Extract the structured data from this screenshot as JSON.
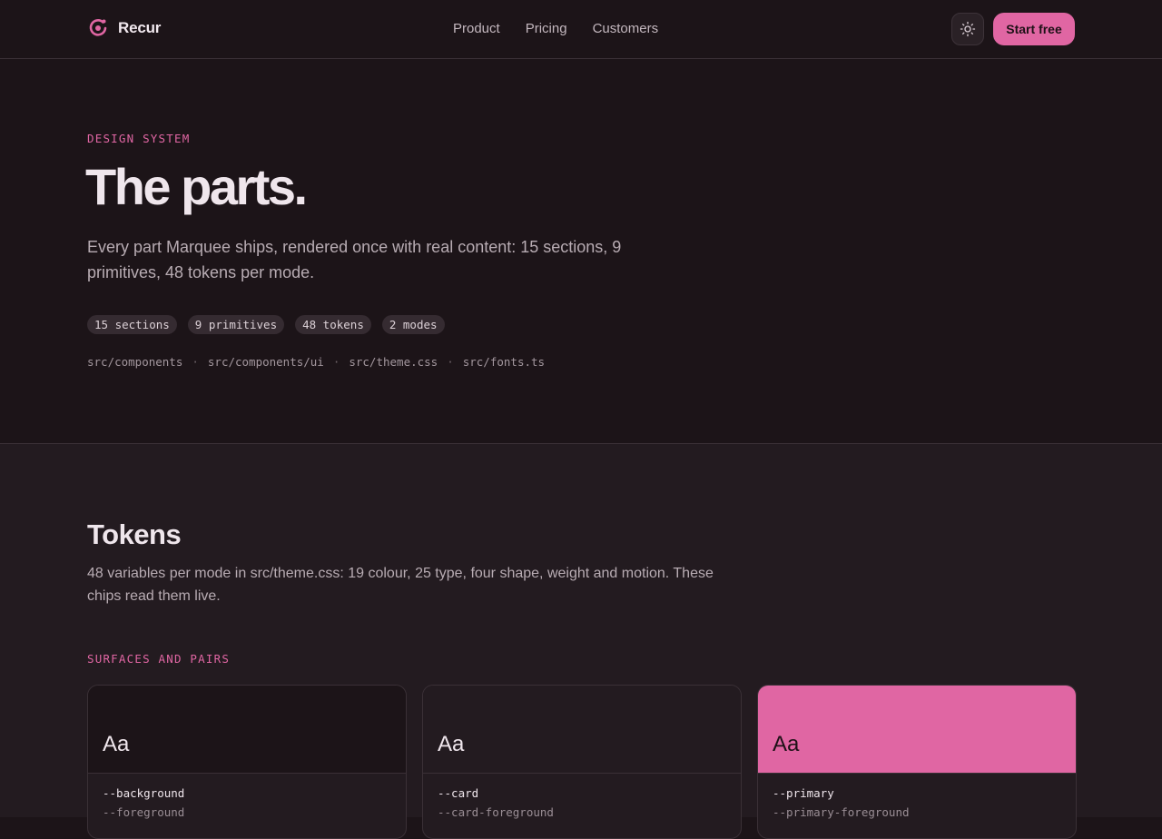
{
  "header": {
    "brand": "Recur",
    "nav": [
      "Product",
      "Pricing",
      "Customers"
    ],
    "theme_toggle_icon": "sun-icon",
    "cta_label": "Start free"
  },
  "hero": {
    "eyebrow": "DESIGN SYSTEM",
    "title": "The parts.",
    "description": "Every part Marquee ships, rendered once with real content: 15 sections, 9 primitives, 48 tokens per mode.",
    "chips": [
      "15 sections",
      "9 primitives",
      "48 tokens",
      "2 modes"
    ],
    "paths": [
      "src/components",
      "src/components/ui",
      "src/theme.css",
      "src/fonts.ts"
    ],
    "path_separator": "·"
  },
  "tokens": {
    "title": "Tokens",
    "description": "48 variables per mode in src/theme.css: 19 colour, 25 type, four shape, weight and motion. These chips read them live.",
    "group_label": "SURFACES AND PAIRS",
    "cards": [
      {
        "sample": "Aa",
        "variable": "--background",
        "pair": "--foreground",
        "bg": "#1c1418",
        "fg": "#efe6ec"
      },
      {
        "sample": "Aa",
        "variable": "--card",
        "pair": "--card-foreground",
        "bg": "#231b20",
        "fg": "#efe6ec"
      },
      {
        "sample": "Aa",
        "variable": "--primary",
        "pair": "--primary-foreground",
        "bg": "#e066a3",
        "fg": "#1e1117"
      }
    ]
  },
  "colors": {
    "accent": "#e066a3",
    "background": "#1c1418",
    "surface": "#231b20"
  }
}
